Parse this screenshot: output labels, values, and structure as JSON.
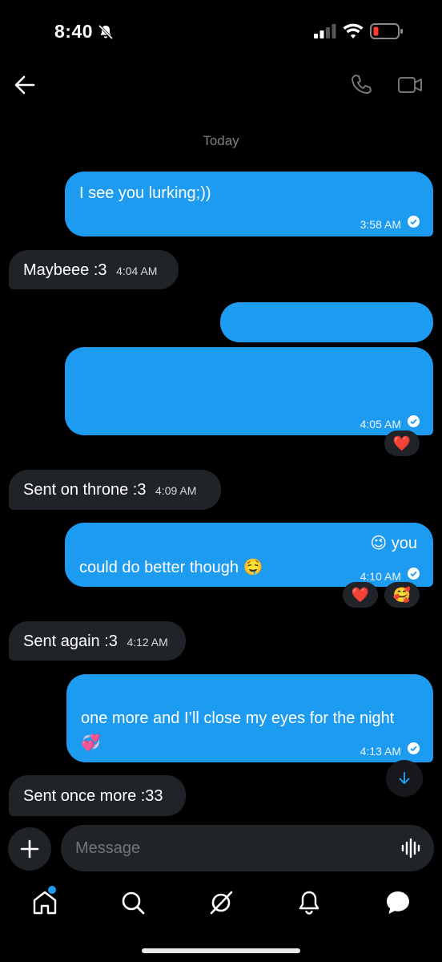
{
  "status": {
    "time": "8:40"
  },
  "conversation": {
    "date_divider": "Today",
    "messages": [
      {
        "text": "I see you lurking;))",
        "time": "3:58 AM"
      },
      {
        "text": "Maybeee :3",
        "time": "4:04 AM"
      },
      {
        "text": "",
        "time": ""
      },
      {
        "text": "",
        "time": "4:05 AM",
        "reactions": [
          "❤️"
        ]
      },
      {
        "text": "Sent on throne :3",
        "time": "4:09 AM"
      },
      {
        "text_line1": "😉 you",
        "text_line2": "could do better though 🤤",
        "time": "4:10 AM",
        "reactions": [
          "❤️",
          "🥰"
        ]
      },
      {
        "text": "Sent again :3",
        "time": "4:12 AM"
      },
      {
        "text_line1": "one more and I’ll close my eyes for the night",
        "text_line2": "💞",
        "time": "4:13 AM"
      },
      {
        "text": "Sent once more :33",
        "time": ""
      }
    ]
  },
  "composer": {
    "placeholder": "Message"
  },
  "colors": {
    "accent": "#1d9bf0",
    "incoming_bubble": "#202327",
    "background": "#000000"
  },
  "tabs": [
    "home-icon",
    "search-icon",
    "grok-icon",
    "notifications-icon",
    "messages-icon"
  ]
}
